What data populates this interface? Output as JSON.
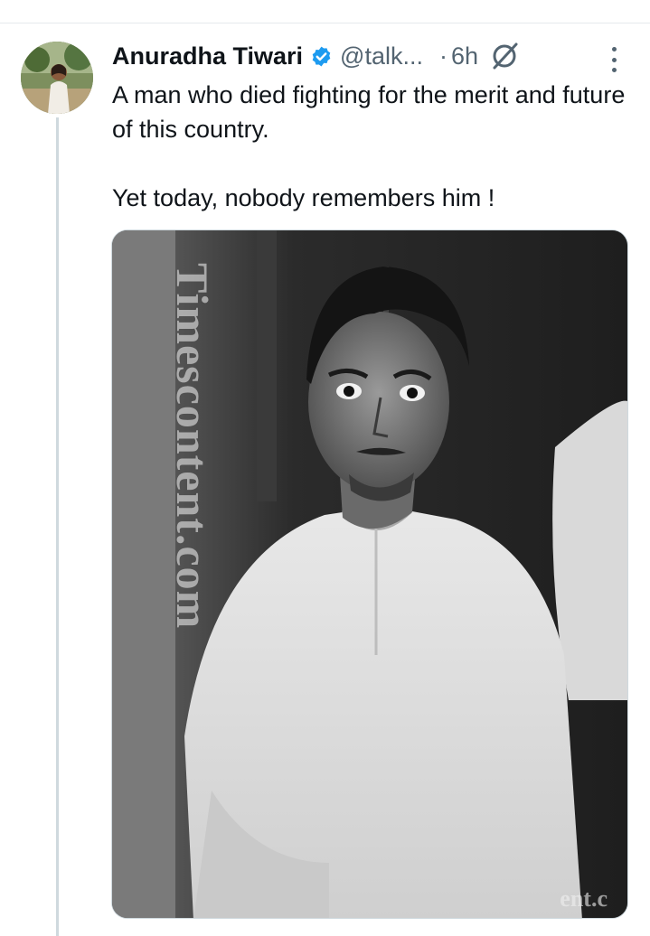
{
  "tweet": {
    "author_name": "Anuradha Tiwari",
    "handle": "@talk...",
    "separator": "·",
    "time": "6h",
    "text_line_1": "A man who died fighting for the merit and future of this country.",
    "text_line_2": "Yet today, nobody remembers him !",
    "icons": {
      "verified": "verified-badge-icon",
      "grok": "grok-icon",
      "more": "more-options-icon"
    },
    "photo": {
      "watermark_side": "Timescontent.com",
      "watermark_corner": "ent.c"
    }
  },
  "colors": {
    "verified_blue": "#1d9bf0",
    "secondary_text": "#536471",
    "primary_text": "#0f1419",
    "thread_line": "#cfd9de"
  }
}
